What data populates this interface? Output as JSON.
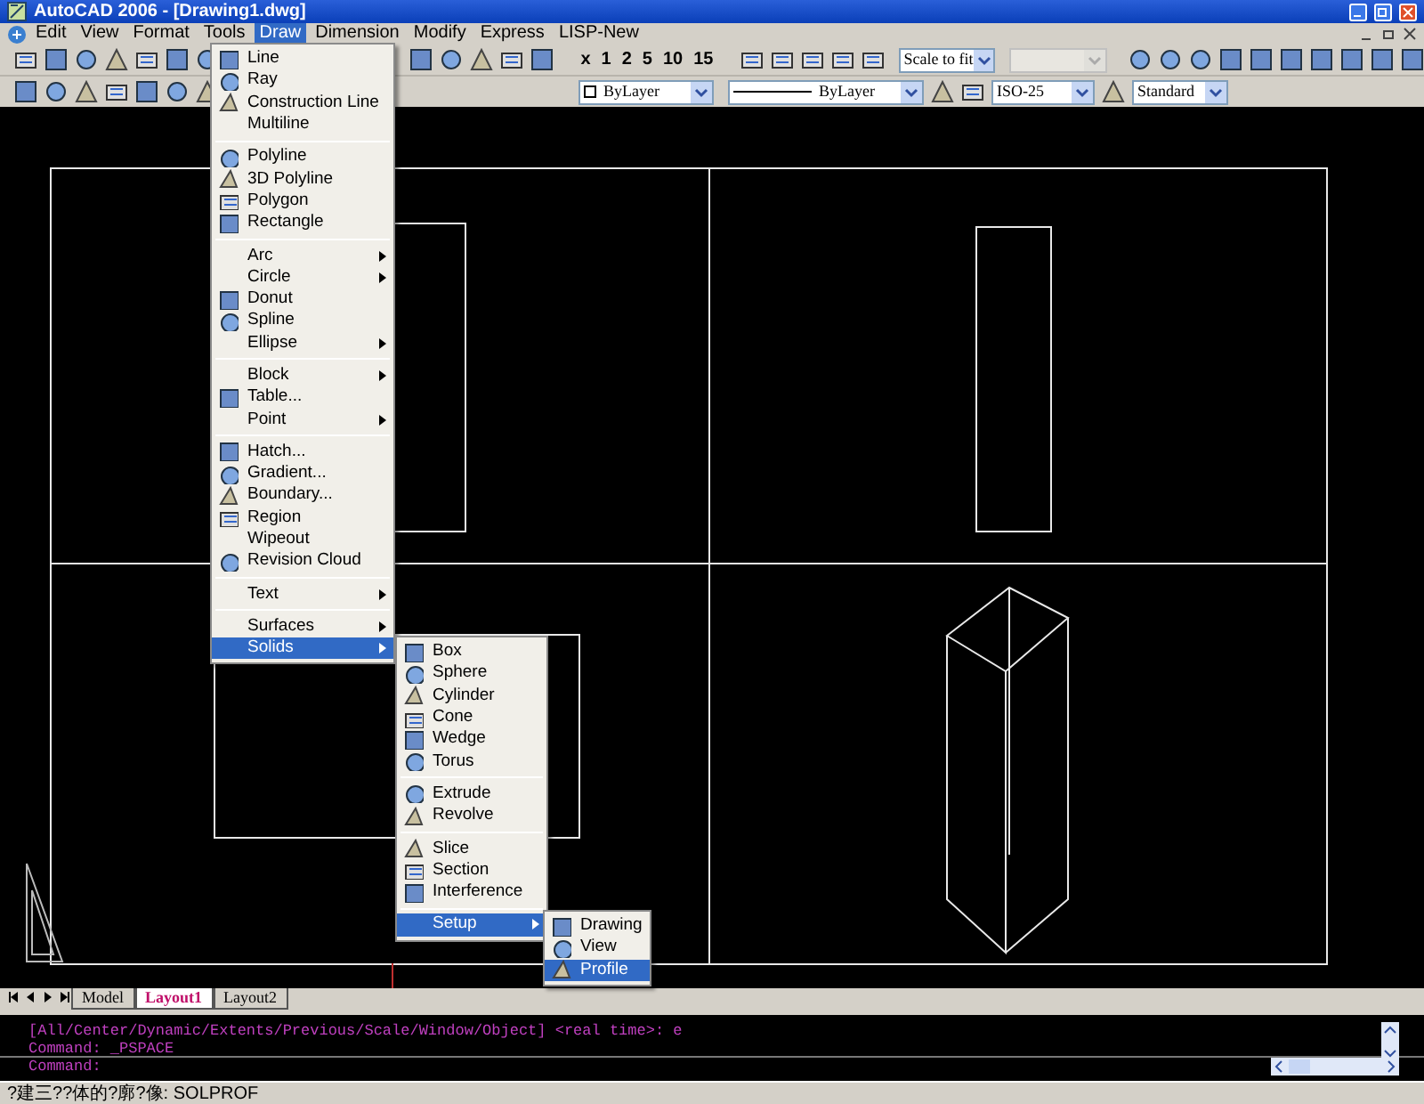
{
  "window": {
    "title": "AutoCAD 2006 - [Drawing1.dwg]"
  },
  "menu_bar": [
    {
      "label": "Edit",
      "selected": false
    },
    {
      "label": "View",
      "selected": false
    },
    {
      "label": "Format",
      "selected": false
    },
    {
      "label": "Tools",
      "selected": false
    },
    {
      "label": "Draw",
      "selected": true
    },
    {
      "label": "Dimension",
      "selected": false
    },
    {
      "label": "Modify",
      "selected": false
    },
    {
      "label": "Express",
      "selected": false
    },
    {
      "label": "LISP-New",
      "selected": false
    }
  ],
  "toolbar_buttons": [
    "x",
    "1",
    "2",
    "5",
    "10",
    "15"
  ],
  "dropdowns": [
    {
      "value": "Scale to fit",
      "disabled": false
    },
    {
      "disabled": true
    },
    {
      "value": "ByLayer",
      "disabled": false,
      "kind": "color"
    },
    {
      "value": "ByLayer",
      "disabled": false,
      "kind": "linetype"
    },
    {
      "value": "ISO-25",
      "disabled": false
    },
    {
      "value": "Standard",
      "disabled": false
    }
  ],
  "draw_menu": [
    [
      {
        "label": "Line",
        "has_icon": true,
        "submenu": false,
        "selected": false
      },
      {
        "label": "Ray",
        "has_icon": true,
        "submenu": false,
        "selected": false
      },
      {
        "label": "Construction Line",
        "has_icon": true,
        "submenu": false,
        "selected": false
      },
      {
        "label": "Multiline",
        "has_icon": false,
        "submenu": false,
        "selected": false
      }
    ],
    [
      {
        "label": "Polyline",
        "has_icon": true,
        "submenu": false,
        "selected": false
      },
      {
        "label": "3D Polyline",
        "has_icon": true,
        "submenu": false,
        "selected": false
      },
      {
        "label": "Polygon",
        "has_icon": true,
        "submenu": false,
        "selected": false
      },
      {
        "label": "Rectangle",
        "has_icon": true,
        "submenu": false,
        "selected": false
      }
    ],
    [
      {
        "label": "Arc",
        "has_icon": false,
        "submenu": true,
        "selected": false
      },
      {
        "label": "Circle",
        "has_icon": false,
        "submenu": true,
        "selected": false
      },
      {
        "label": "Donut",
        "has_icon": true,
        "submenu": false,
        "selected": false
      },
      {
        "label": "Spline",
        "has_icon": true,
        "submenu": false,
        "selected": false
      },
      {
        "label": "Ellipse",
        "has_icon": false,
        "submenu": true,
        "selected": false
      }
    ],
    [
      {
        "label": "Block",
        "has_icon": false,
        "submenu": true,
        "selected": false
      },
      {
        "label": "Table...",
        "has_icon": true,
        "submenu": false,
        "selected": false
      },
      {
        "label": "Point",
        "has_icon": false,
        "submenu": true,
        "selected": false
      }
    ],
    [
      {
        "label": "Hatch...",
        "has_icon": true,
        "submenu": false,
        "selected": false
      },
      {
        "label": "Gradient...",
        "has_icon": true,
        "submenu": false,
        "selected": false
      },
      {
        "label": "Boundary...",
        "has_icon": true,
        "submenu": false,
        "selected": false
      },
      {
        "label": "Region",
        "has_icon": true,
        "submenu": false,
        "selected": false
      },
      {
        "label": "Wipeout",
        "has_icon": false,
        "submenu": false,
        "selected": false
      },
      {
        "label": "Revision Cloud",
        "has_icon": true,
        "submenu": false,
        "selected": false
      }
    ],
    [
      {
        "label": "Text",
        "has_icon": false,
        "submenu": true,
        "selected": false
      }
    ],
    [
      {
        "label": "Surfaces",
        "has_icon": false,
        "submenu": true,
        "selected": false
      },
      {
        "label": "Solids",
        "has_icon": false,
        "submenu": true,
        "selected": true
      }
    ]
  ],
  "solids_menu": [
    [
      {
        "label": "Box",
        "has_icon": true,
        "submenu": false,
        "selected": false
      },
      {
        "label": "Sphere",
        "has_icon": true,
        "submenu": false,
        "selected": false
      },
      {
        "label": "Cylinder",
        "has_icon": true,
        "submenu": false,
        "selected": false
      },
      {
        "label": "Cone",
        "has_icon": true,
        "submenu": false,
        "selected": false
      },
      {
        "label": "Wedge",
        "has_icon": true,
        "submenu": false,
        "selected": false
      },
      {
        "label": "Torus",
        "has_icon": true,
        "submenu": false,
        "selected": false
      }
    ],
    [
      {
        "label": "Extrude",
        "has_icon": true,
        "submenu": false,
        "selected": false
      },
      {
        "label": "Revolve",
        "has_icon": true,
        "submenu": false,
        "selected": false
      }
    ],
    [
      {
        "label": "Slice",
        "has_icon": true,
        "submenu": false,
        "selected": false
      },
      {
        "label": "Section",
        "has_icon": true,
        "submenu": false,
        "selected": false
      },
      {
        "label": "Interference",
        "has_icon": true,
        "submenu": false,
        "selected": false
      }
    ],
    [
      {
        "label": "Setup",
        "has_icon": false,
        "submenu": true,
        "selected": true
      }
    ]
  ],
  "setup_menu": [
    [
      {
        "label": "Drawing",
        "has_icon": true,
        "submenu": false,
        "selected": false
      },
      {
        "label": "View",
        "has_icon": true,
        "submenu": false,
        "selected": false
      },
      {
        "label": "Profile",
        "has_icon": true,
        "submenu": false,
        "selected": true
      }
    ]
  ],
  "layout_tabs": [
    {
      "label": "Model",
      "selected": false
    },
    {
      "label": "Layout1",
      "selected": true
    },
    {
      "label": "Layout2",
      "selected": false
    }
  ],
  "command_history": [
    "[All/Center/Dynamic/Extents/Previous/Scale/Window/Object] <real time>: e",
    "Command: _PSPACE"
  ],
  "command_prompt": "Command:",
  "status_bar": "?建三??体的?廓?像: SOLPROF"
}
